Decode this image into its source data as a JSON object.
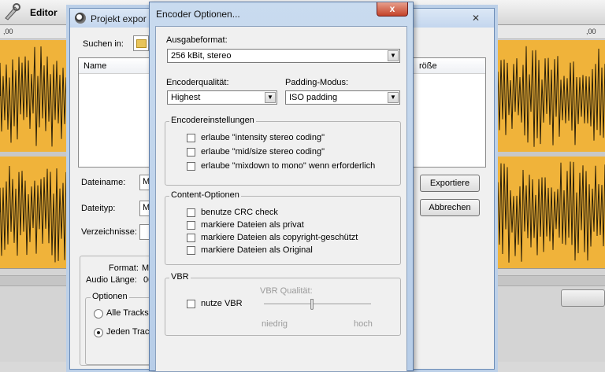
{
  "editor": {
    "title": "Editor",
    "ruler": {
      "left_time": ",00",
      "right_time": ",00"
    }
  },
  "export_dialog": {
    "title": "Projekt expor",
    "search_in_label": "Suchen in:",
    "column_name": "Name",
    "column_size": "röße",
    "filename_label": "Dateiname:",
    "filename_value": "M",
    "filetype_label": "Dateityp:",
    "filetype_value": "M",
    "directories_label": "Verzeichnisse:",
    "export_button": "Exportiere",
    "cancel_button": "Abbrechen",
    "format_label": "Format:",
    "format_value": "M",
    "audio_length_label": "Audio Länge:",
    "audio_length_value": "00",
    "options_title": "Optionen",
    "radio_all_tracks": "Alle Tracks",
    "radio_each_track": "Jeden Trac"
  },
  "encoder_dialog": {
    "title": "Encoder Optionen...",
    "close_label": "x",
    "output_format_label": "Ausgabeformat:",
    "output_format_value": "256 kBit, stereo",
    "quality_label": "Encoderqualität:",
    "quality_value": "Highest",
    "padding_label": "Padding-Modus:",
    "padding_value": "ISO padding",
    "encoder_settings": {
      "title": "Encodereinstellungen",
      "items": [
        {
          "label": "erlaube \"intensity stereo coding\"",
          "checked": false
        },
        {
          "label": "erlaube \"mid/size stereo coding\"",
          "checked": false
        },
        {
          "label": "erlaube \"mixdown to mono\" wenn erforderlich",
          "checked": false
        }
      ]
    },
    "content_options": {
      "title": "Content-Optionen",
      "items": [
        {
          "label": "benutze CRC check",
          "checked": false
        },
        {
          "label": "markiere Dateien als privat",
          "checked": false
        },
        {
          "label": "markiere Dateien als copyright-geschützt",
          "checked": false
        },
        {
          "label": "markiere Dateien als Original",
          "checked": false
        }
      ]
    },
    "vbr": {
      "title": "VBR",
      "use_vbr_label": "nutze VBR",
      "use_vbr_checked": false,
      "quality_label": "VBR Qualität:",
      "low_label": "niedrig",
      "high_label": "hoch",
      "quality_level": 0.45
    }
  },
  "colors": {
    "waveform_bg": "#f0b33a",
    "waveform": "#2a1f08"
  }
}
